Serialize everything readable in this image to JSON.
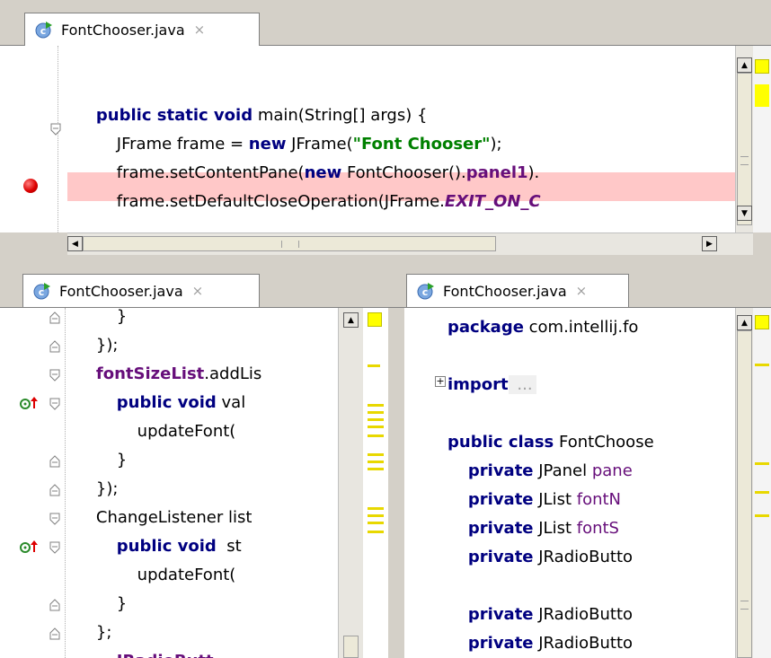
{
  "top_pane": {
    "tab_label": "FontChooser.java",
    "close_glyph": "×",
    "lines": [
      {
        "indent": "    ",
        "segments": [
          {
            "t": "public static void",
            "c": "kw"
          },
          {
            "t": " main(String[] args) {",
            "c": ""
          }
        ]
      },
      {
        "indent": "        ",
        "segments": [
          {
            "t": "JFrame frame = ",
            "c": ""
          },
          {
            "t": "new",
            "c": "kw"
          },
          {
            "t": " JFrame(",
            "c": ""
          },
          {
            "t": "\"Font Chooser\"",
            "c": "str"
          },
          {
            "t": ");",
            "c": ""
          }
        ]
      },
      {
        "indent": "        ",
        "segments": [
          {
            "t": "frame.setContentPane(",
            "c": ""
          },
          {
            "t": "new",
            "c": "kw"
          },
          {
            "t": " FontChooser().",
            "c": ""
          },
          {
            "t": "panel1",
            "c": "fld"
          },
          {
            "t": ").",
            "c": ""
          }
        ]
      },
      {
        "indent": "        ",
        "segments": [
          {
            "t": "frame.setDefaultCloseOperation(JFrame.",
            "c": ""
          },
          {
            "t": "EXIT_ON_C",
            "c": "cst"
          }
        ]
      }
    ],
    "breakpoint_line": 3,
    "highlight_color": "#ffc8c8"
  },
  "left_pane": {
    "tab_label": "FontChooser.java",
    "close_glyph": "×",
    "lines": [
      {
        "indent": "        ",
        "segments": [
          {
            "t": "}",
            "c": ""
          }
        ]
      },
      {
        "indent": "    ",
        "segments": [
          {
            "t": "});",
            "c": ""
          }
        ]
      },
      {
        "indent": "    ",
        "segments": [
          {
            "t": "fontSizeList",
            "c": "fld"
          },
          {
            "t": ".addLis",
            "c": ""
          }
        ]
      },
      {
        "indent": "        ",
        "segments": [
          {
            "t": "public void",
            "c": "kw"
          },
          {
            "t": " val",
            "c": ""
          }
        ]
      },
      {
        "indent": "            ",
        "segments": [
          {
            "t": "updateFont(",
            "c": ""
          }
        ]
      },
      {
        "indent": "        ",
        "segments": [
          {
            "t": "}",
            "c": ""
          }
        ]
      },
      {
        "indent": "    ",
        "segments": [
          {
            "t": "});",
            "c": ""
          }
        ]
      },
      {
        "indent": "    ",
        "segments": [
          {
            "t": "ChangeListener list",
            "c": ""
          }
        ]
      },
      {
        "indent": "        ",
        "segments": [
          {
            "t": "public void",
            "c": "kw"
          },
          {
            "t": "  st",
            "c": ""
          }
        ]
      },
      {
        "indent": "            ",
        "segments": [
          {
            "t": "updateFont(",
            "c": ""
          }
        ]
      },
      {
        "indent": "        ",
        "segments": [
          {
            "t": "}",
            "c": ""
          }
        ]
      },
      {
        "indent": "    ",
        "segments": [
          {
            "t": "};",
            "c": ""
          }
        ]
      },
      {
        "indent": "        ",
        "segments": [
          {
            "t": "JRadioButt",
            "c": "fld"
          }
        ]
      }
    ],
    "override_icon_lines": [
      4,
      9
    ]
  },
  "right_pane": {
    "tab_label": "FontChooser.java",
    "close_glyph": "×",
    "lines": [
      {
        "indent": "",
        "segments": [
          {
            "t": "package",
            "c": "kw"
          },
          {
            "t": " com.intellij.fo",
            "c": ""
          }
        ]
      },
      {
        "indent": "",
        "segments": []
      },
      {
        "indent": "",
        "segments": [
          {
            "t": "import",
            "c": "kw"
          },
          {
            "t": " ...",
            "c": "fold-text"
          }
        ]
      },
      {
        "indent": "",
        "segments": []
      },
      {
        "indent": "",
        "segments": [
          {
            "t": "public class",
            "c": "kw"
          },
          {
            "t": " FontChoose",
            "c": ""
          }
        ]
      },
      {
        "indent": "    ",
        "segments": [
          {
            "t": "private",
            "c": "kw"
          },
          {
            "t": " JPanel ",
            "c": ""
          },
          {
            "t": "pane",
            "c": "fldn"
          }
        ]
      },
      {
        "indent": "    ",
        "segments": [
          {
            "t": "private",
            "c": "kw"
          },
          {
            "t": " JList ",
            "c": ""
          },
          {
            "t": "fontN",
            "c": "fldn"
          }
        ]
      },
      {
        "indent": "    ",
        "segments": [
          {
            "t": "private",
            "c": "kw"
          },
          {
            "t": " JList ",
            "c": ""
          },
          {
            "t": "fontS",
            "c": "fldn"
          }
        ]
      },
      {
        "indent": "    ",
        "segments": [
          {
            "t": "private",
            "c": "kw"
          },
          {
            "t": " JRadioButto",
            "c": ""
          }
        ]
      },
      {
        "indent": "",
        "segments": []
      },
      {
        "indent": "    ",
        "segments": [
          {
            "t": "private",
            "c": "kw"
          },
          {
            "t": " JRadioButto",
            "c": ""
          }
        ]
      },
      {
        "indent": "    ",
        "segments": [
          {
            "t": "private",
            "c": "kw"
          },
          {
            "t": " JRadioButto",
            "c": ""
          }
        ]
      }
    ]
  },
  "colors": {
    "keyword": "#000080",
    "string": "#008000",
    "field": "#660e7a",
    "marker_yellow": "#e8d800",
    "breakpoint_red": "#dd0000"
  }
}
